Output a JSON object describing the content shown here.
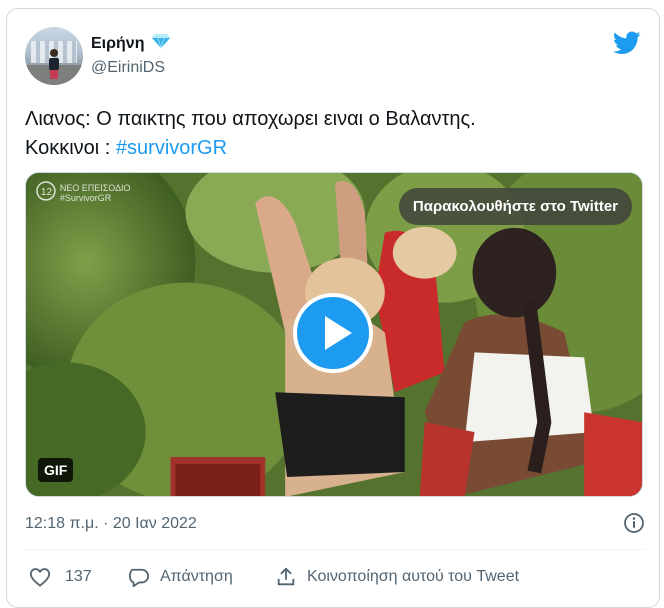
{
  "tweet": {
    "author": {
      "display_name": "Ειρήνη",
      "handle": "@EiriniDS",
      "badge_icon": "gem-icon"
    },
    "text_line_1": "Λιανος: Ο παικτης που αποχωρει ειναι ο Βαλαντης.",
    "text_line_2_prefix": "Κοκκινοι : ",
    "hashtag": "#survivorGR",
    "media": {
      "watch_label": "Παρακολουθήστε στο Twitter",
      "gif_label": "GIF"
    },
    "timestamp": "12:18 π.μ. · 20 Ιαν 2022",
    "actions": {
      "like_count": "137",
      "reply_label": "Απάντηση",
      "share_label": "Κοινοποίηση αυτού του Tweet"
    }
  },
  "colors": {
    "accent": "#1d9bf0",
    "text": "#0f1419",
    "muted": "#536471",
    "border": "#cfd9de"
  }
}
